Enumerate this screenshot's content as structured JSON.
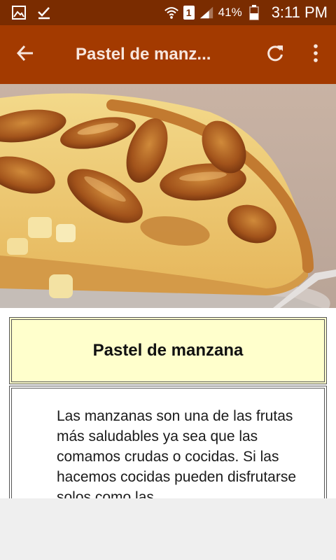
{
  "status_bar": {
    "battery_percent": "41%",
    "time": "3:11 PM",
    "sim_label": "1",
    "left_icons": [
      "image-icon",
      "check-icon"
    ],
    "right_icons": [
      "wifi-icon",
      "sim-icon",
      "signal-icon",
      "battery-icon"
    ]
  },
  "app_bar": {
    "title": "Pastel de manz...",
    "back_icon": "arrow-back-icon",
    "refresh_icon": "refresh-icon",
    "menu_icon": "more-vert-icon"
  },
  "recipe": {
    "title": "Pastel de manzana",
    "description": "Las manzanas son una de las frutas más saludables ya sea que las comamos crudas o cocidas. Si las hacemos cocidas pueden disfrutarse solos como las"
  },
  "colors": {
    "status_bar": "#7a2c00",
    "app_bar": "#a33a00",
    "title_card_bg": "#ffffcc"
  }
}
